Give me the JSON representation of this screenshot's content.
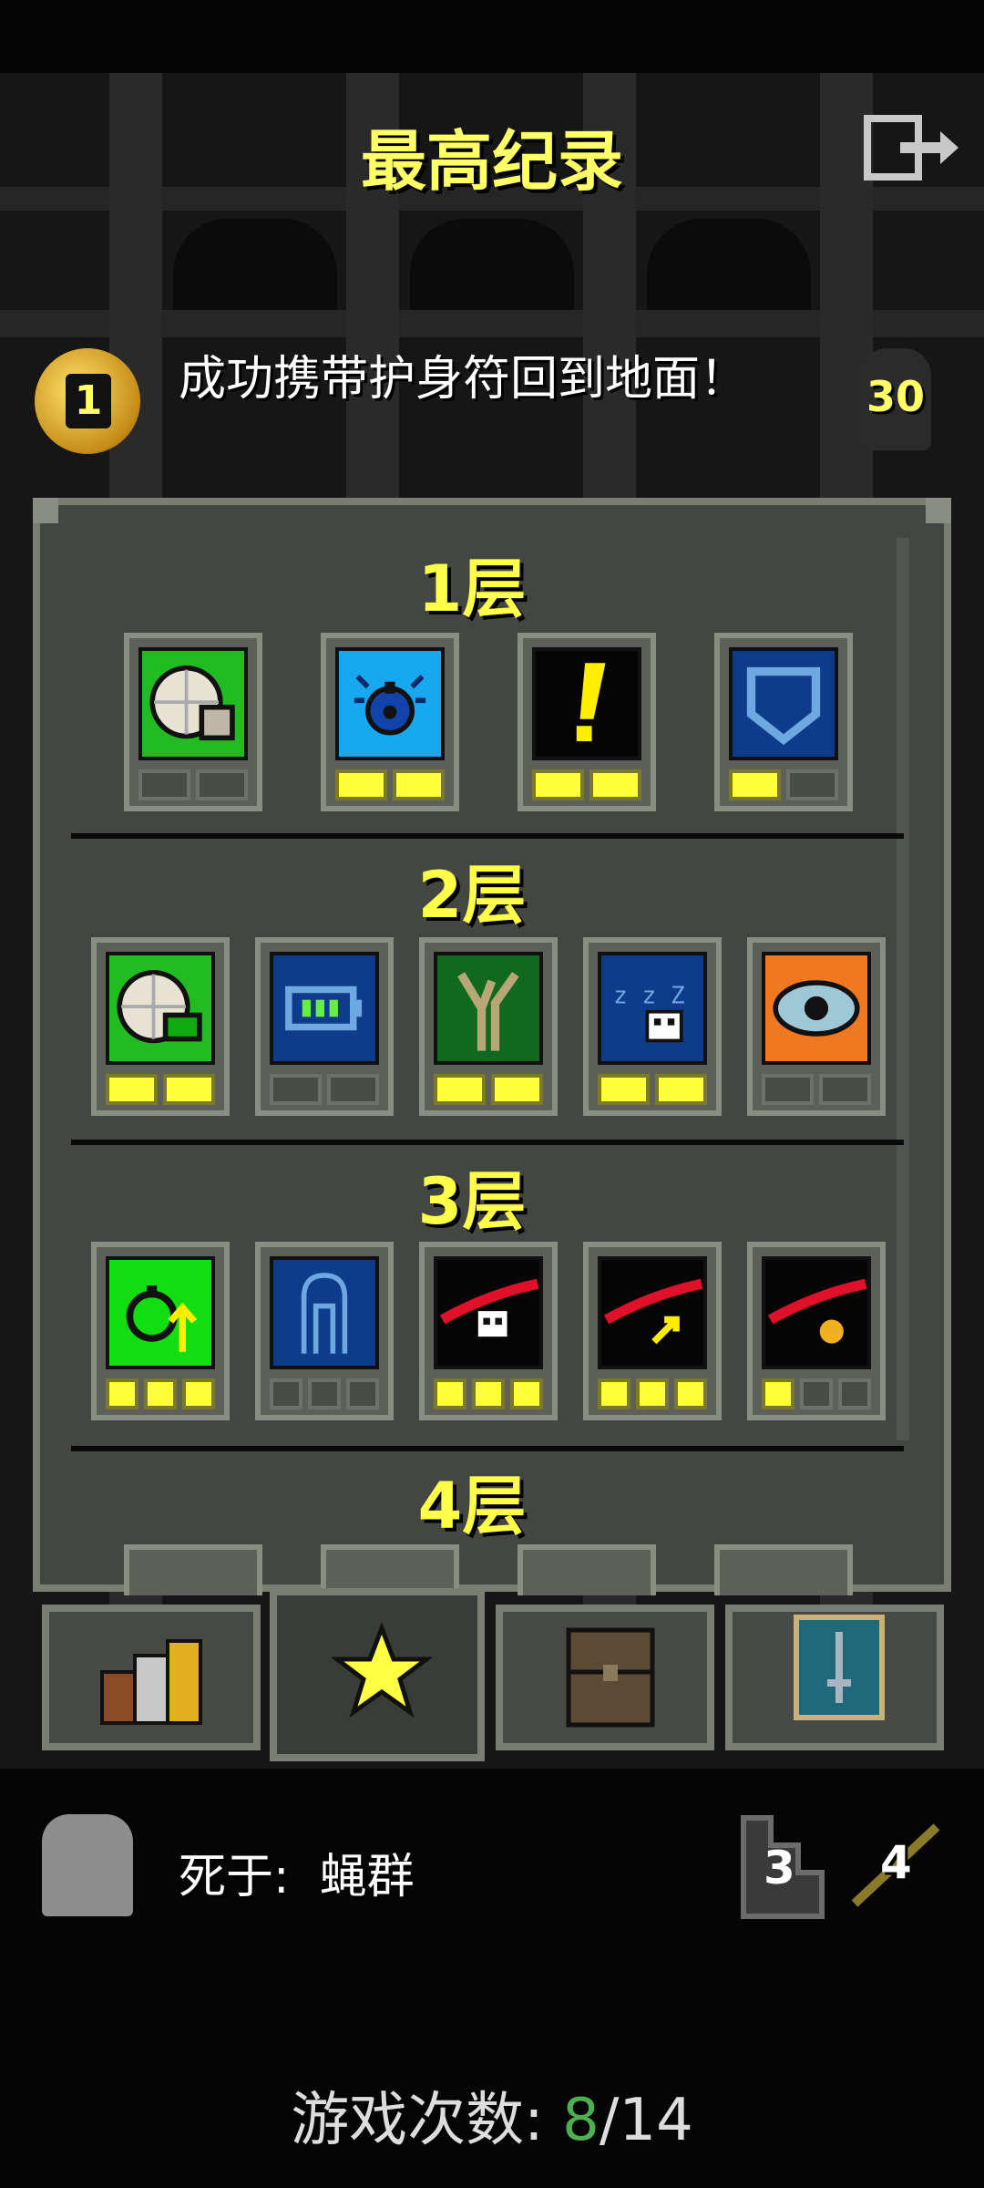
{
  "title": "最高纪录",
  "exit_icon": "exit-door-icon",
  "record": {
    "badge_number": "1",
    "text": "成功携带护身符回到地面！",
    "score": "30"
  },
  "floors": [
    {
      "label": "1层",
      "badges": [
        {
          "icon": "clock-box-icon",
          "pips": [
            0,
            0
          ]
        },
        {
          "icon": "blue-bomb-icon",
          "pips": [
            1,
            1
          ]
        },
        {
          "icon": "exclamation-icon",
          "pips": [
            1,
            1
          ]
        },
        {
          "icon": "shield-icon",
          "pips": [
            1,
            0
          ]
        }
      ]
    },
    {
      "label": "2层",
      "badges": [
        {
          "icon": "clock-battery-icon",
          "pips": [
            1,
            1
          ]
        },
        {
          "icon": "battery-icon",
          "pips": [
            0,
            0
          ]
        },
        {
          "icon": "tree-icon",
          "pips": [
            1,
            1
          ]
        },
        {
          "icon": "sleep-skull-icon",
          "pips": [
            1,
            1
          ]
        },
        {
          "icon": "eye-icon",
          "pips": [
            0,
            0
          ]
        }
      ]
    },
    {
      "label": "3层",
      "badges": [
        {
          "icon": "bomb-arrow-icon",
          "pips": [
            1,
            1,
            1
          ]
        },
        {
          "icon": "ghost-outline-icon",
          "pips": [
            0,
            0,
            0
          ]
        },
        {
          "icon": "slash-skull-icon",
          "pips": [
            1,
            1,
            1
          ]
        },
        {
          "icon": "slash-arrow-icon",
          "pips": [
            1,
            1,
            1
          ]
        },
        {
          "icon": "slash-coin-icon",
          "pips": [
            1,
            0,
            0
          ]
        }
      ]
    },
    {
      "label": "4层",
      "badges": []
    }
  ],
  "tabs": [
    {
      "icon": "books-icon"
    },
    {
      "icon": "star-icon"
    },
    {
      "icon": "chest-icon"
    },
    {
      "icon": "sword-card-icon"
    }
  ],
  "bottom": {
    "death_label": "死于:",
    "death_cause": "蝇群",
    "depth": "3",
    "level": "4"
  },
  "games": {
    "label": "游戏次数:",
    "won": "8",
    "total": "14"
  },
  "colors": {
    "accent": "#ffff4a",
    "green": "#4caf50"
  }
}
